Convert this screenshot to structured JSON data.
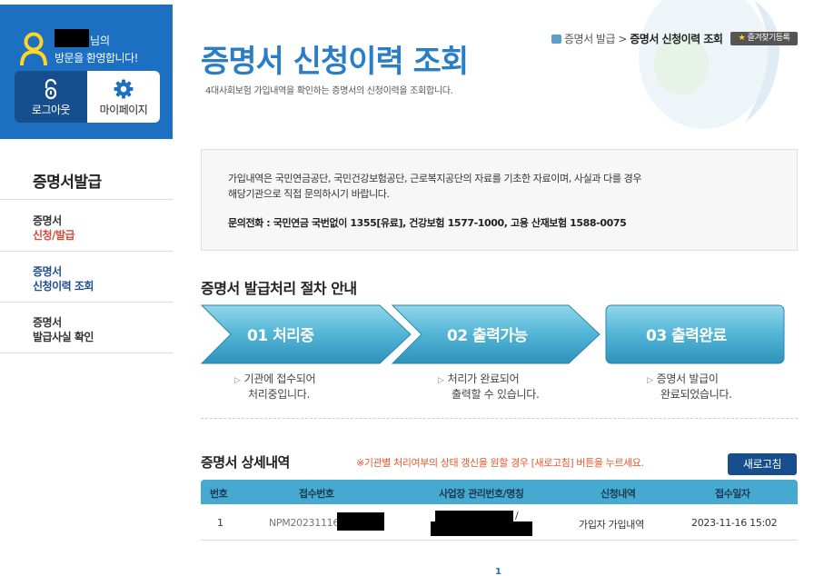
{
  "sidebar": {
    "welcome": {
      "suffix": "님의",
      "line2": "방문을 환영합니다!"
    },
    "logout_label": "로그아웃",
    "mypage_label": "마이페이지",
    "title": "증명서발급",
    "items": [
      {
        "line1": "증명서",
        "line2": "신청/발급",
        "color": "#d94a3b"
      },
      {
        "line1": "증명서",
        "line2": "신청이력 조회",
        "color": "#1d4f8f"
      },
      {
        "line1": "증명서",
        "line2": "발급사실 확인",
        "color": "#333333"
      }
    ]
  },
  "header": {
    "title": "증명서 신청이력 조회",
    "description": "4대사회보험 가입내역을 확인하는 증명서의 신청이력을 조회합니다.",
    "breadcrumb_parent": "증명서 발급",
    "breadcrumb_sep": ">",
    "breadcrumb_current": "증명서 신청이력 조회",
    "favorite_label": "즐겨찾기등록"
  },
  "info": {
    "line1": "가입내역은 국민연금공단, 국민건강보험공단, 근로복지공단의 자료를 기초한 자료이며, 사실과 다를 경우",
    "line2": "해당기관으로 직접 문의하시기 바랍니다.",
    "phone": "문의전화 : 국민연금 국번없이 1355[유료], 건강보험 1577-1000, 고용 산재보험 1588-0075"
  },
  "process": {
    "title": "증명서 발급처리 절차 안내",
    "steps": [
      {
        "label": "01 처리중",
        "desc1": "기관에 접수되어",
        "desc2": "처리중입니다."
      },
      {
        "label": "02 출력가능",
        "desc1": "처리가 완료되어",
        "desc2": "출력할 수 있습니다."
      },
      {
        "label": "03 출력완료",
        "desc1": "증명서 발급이",
        "desc2": "완료되었습니다."
      }
    ]
  },
  "detail": {
    "title": "증명서 상세내역",
    "notice": "※기관별 처리여부의 상태 갱신을 원할 경우 [새로고침] 버튼을 누르세요.",
    "refresh_label": "새로고침",
    "columns": [
      "번호",
      "접수번호",
      "사업장 관리번호/명칭",
      "신청내역",
      "접수일자"
    ],
    "rows": [
      {
        "no": "1",
        "receipt_no": "NPM20231116",
        "workplace": "/",
        "request": "가입자 가입내역",
        "date": "2023-11-16 15:02"
      }
    ]
  },
  "pagination": {
    "current": "1"
  },
  "colors": {
    "brand_blue": "#1d6fc1",
    "title_blue": "#2a7ec6",
    "table_header": "#46a9cf",
    "notice": "#e8572e"
  }
}
